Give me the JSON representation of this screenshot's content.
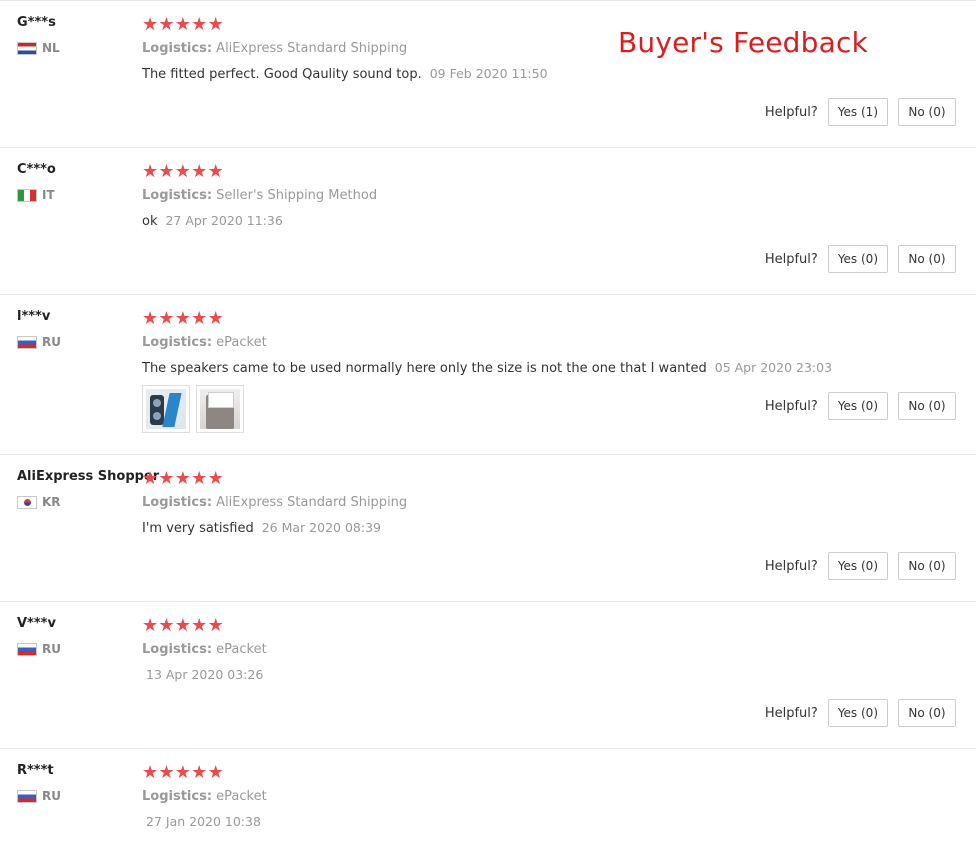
{
  "page_title": "Buyer's Feedback",
  "labels": {
    "logistics": "Logistics:",
    "helpful": "Helpful?"
  },
  "colors": {
    "title": "#d81e1e",
    "star": "#e84c4c",
    "muted_text": "#999999"
  },
  "star_icon": "★",
  "reviews": [
    {
      "user": "G***s",
      "country": "NL",
      "flag": "nl",
      "rating": 5,
      "logistics": "AliExpress Standard Shipping",
      "text": "The fitted perfect. Good Qaulity sound top.",
      "date": "09 Feb 2020 11:50",
      "yes": "Yes (1)",
      "no": "No (0)"
    },
    {
      "user": "C***o",
      "country": "IT",
      "flag": "it",
      "rating": 5,
      "logistics": "Seller's Shipping Method",
      "text": "ok",
      "date": "27 Apr 2020 11:36",
      "yes": "Yes (0)",
      "no": "No (0)"
    },
    {
      "user": "l***v",
      "country": "RU",
      "flag": "ru",
      "rating": 5,
      "logistics": "ePacket",
      "text": "The speakers came to be used normally here only the size is not the one that I wanted",
      "date": "05 Apr 2020 23:03",
      "photos": [
        "speaker-photo",
        "package-photo"
      ],
      "yes": "Yes (0)",
      "no": "No (0)"
    },
    {
      "user": "AliExpress Shopper",
      "country": "KR",
      "flag": "kr",
      "rating": 5,
      "logistics": "AliExpress Standard Shipping",
      "text": "I'm very satisfied",
      "date": "26 Mar 2020 08:39",
      "yes": "Yes (0)",
      "no": "No (0)"
    },
    {
      "user": "V***v",
      "country": "RU",
      "flag": "ru",
      "rating": 5,
      "logistics": "ePacket",
      "text": "",
      "date": "13 Apr 2020 03:26",
      "yes": "Yes (0)",
      "no": "No (0)"
    },
    {
      "user": "R***t",
      "country": "RU",
      "flag": "ru",
      "rating": 5,
      "logistics": "ePacket",
      "text": "",
      "date": "27 Jan 2020 10:38"
    }
  ]
}
